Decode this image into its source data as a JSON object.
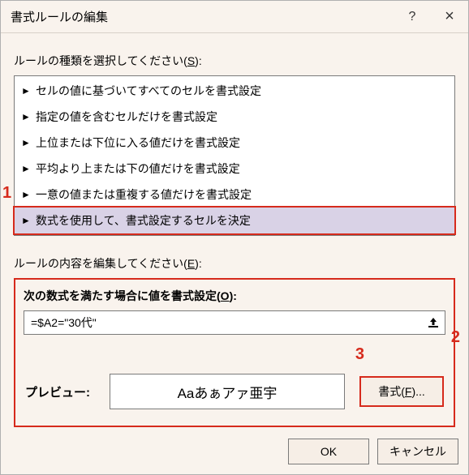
{
  "title": "書式ルールの編集",
  "help_icon": "?",
  "close_icon": "×",
  "rule_type_label_pre": "ルールの種類を選択してください(",
  "rule_type_label_u": "S",
  "rule_type_label_post": "):",
  "rules": [
    "セルの値に基づいてすべてのセルを書式設定",
    "指定の値を含むセルだけを書式設定",
    "上位または下位に入る値だけを書式設定",
    "平均より上または下の値だけを書式設定",
    "一意の値または重複する値だけを書式設定",
    "数式を使用して、書式設定するセルを決定"
  ],
  "selected_rule_index": 5,
  "rule_desc_label_pre": "ルールの内容を編集してください(",
  "rule_desc_label_u": "E",
  "rule_desc_label_post": "):",
  "formula_heading_pre": "次の数式を満たす場合に値を書式設定(",
  "formula_heading_u": "O",
  "formula_heading_post": "):",
  "formula_value": "=$A2=\"30代\"",
  "preview_label": "プレビュー:",
  "preview_text": "Aaあぁアァ亜宇",
  "format_btn_pre": "書式(",
  "format_btn_u": "F",
  "format_btn_post": ")...",
  "ok_label": "OK",
  "cancel_label": "キャンセル",
  "annotations": {
    "a1": "1",
    "a2": "2",
    "a3": "3"
  }
}
